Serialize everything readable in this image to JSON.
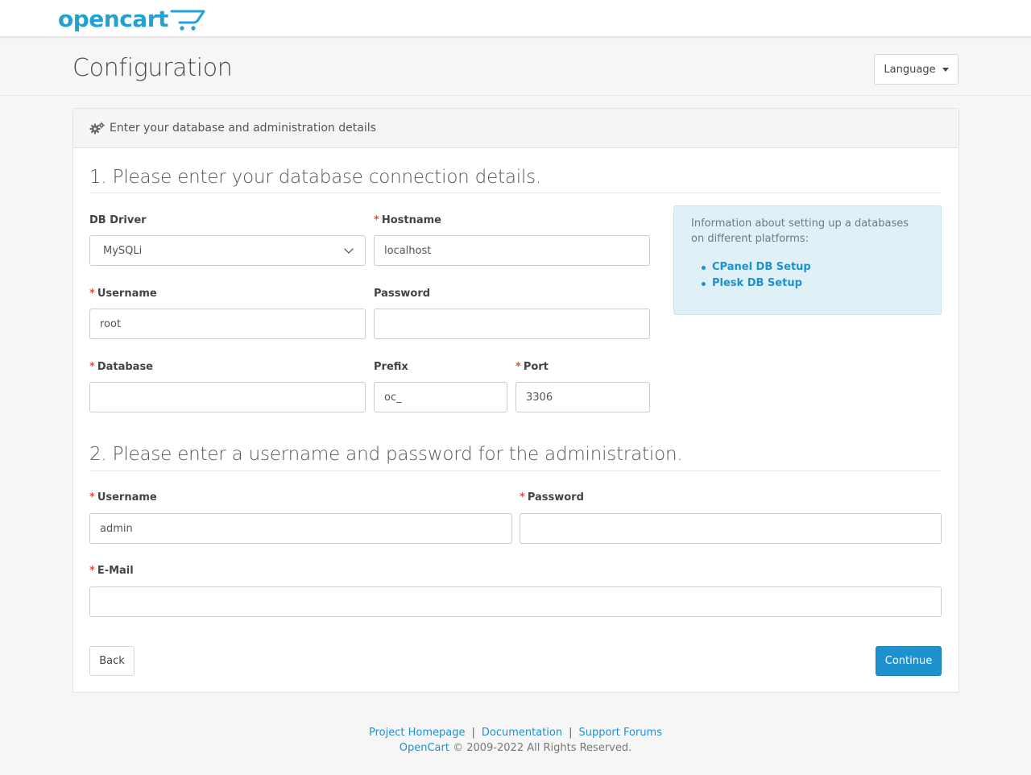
{
  "brand": {
    "name": "opencart",
    "color": "#23a1d1"
  },
  "header": {
    "title": "Configuration",
    "language_label": "Language"
  },
  "panel": {
    "heading": "Enter your database and administration details",
    "heading_icon": "gears-icon"
  },
  "section1": {
    "title": "1. Please enter your database connection details.",
    "db_driver": {
      "label": "DB Driver",
      "value": "MySQLi"
    },
    "hostname": {
      "label": "Hostname",
      "value": "localhost"
    },
    "username": {
      "label": "Username",
      "value": "root"
    },
    "password": {
      "label": "Password",
      "value": ""
    },
    "database": {
      "label": "Database",
      "value": ""
    },
    "prefix": {
      "label": "Prefix",
      "value": "oc_"
    },
    "port": {
      "label": "Port",
      "value": "3306"
    },
    "info": {
      "text": "Information about setting up a databases on different platforms:",
      "links": [
        "CPanel DB Setup",
        "Plesk DB Setup"
      ]
    }
  },
  "section2": {
    "title": "2. Please enter a username and password for the administration.",
    "username": {
      "label": "Username",
      "value": "admin"
    },
    "password": {
      "label": "Password",
      "value": ""
    },
    "email": {
      "label": "E-Mail",
      "value": ""
    }
  },
  "buttons": {
    "back": "Back",
    "continue": "Continue"
  },
  "footer": {
    "links": [
      "Project Homepage",
      "Documentation",
      "Support Forums"
    ],
    "separator": "|",
    "brand_link": "OpenCart",
    "copyright": "© 2009-2022 All Rights Reserved."
  },
  "colors": {
    "accent": "#1e91cf",
    "required": "#e3503e",
    "info_bg": "#dff0f7"
  }
}
